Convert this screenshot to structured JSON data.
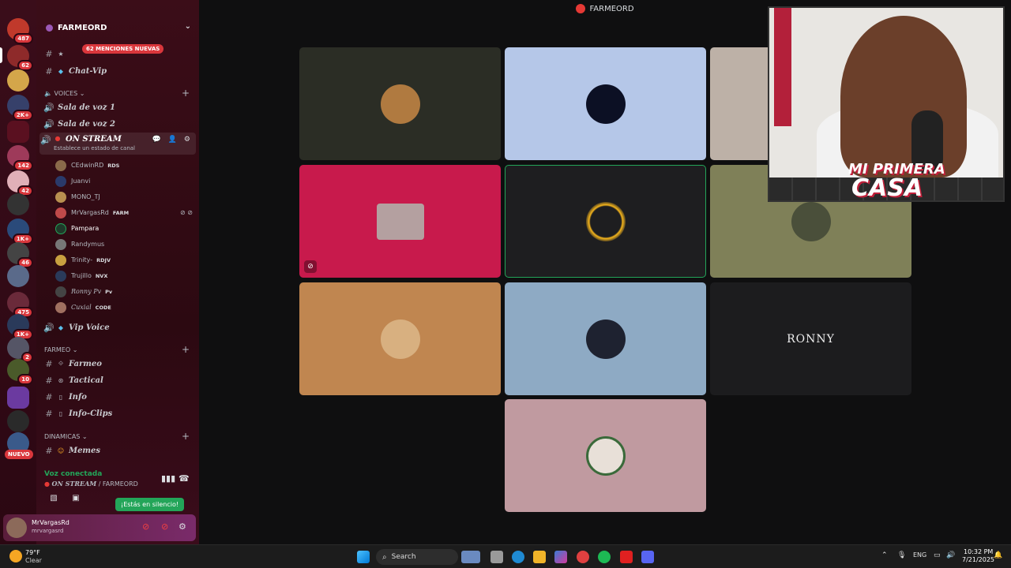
{
  "window": {
    "title": "FARMEORD"
  },
  "rail": {
    "badges": [
      "487",
      "62",
      "2K+",
      "142",
      "42",
      "1K+",
      "46",
      "475",
      "1K+",
      "2",
      "10"
    ],
    "new_label": "NUEVO"
  },
  "server": {
    "name": "FARMEORD",
    "mentions_pill": "62 MENCIONES NUEVAS"
  },
  "channels": {
    "chat_vip": "Chat-Vip",
    "voices_cat": "VOICES",
    "sala1": "Sala de voz 1",
    "sala2": "Sala de voz 2",
    "on_stream": "ON STREAM",
    "on_stream_status": "Establece un estado de canal",
    "vip_voice": "Vip Voice",
    "farmeo_cat": "FARMEO",
    "farmeo": "Farmeo",
    "tactical": "Tactical",
    "info": "Info",
    "info_clips": "Info-Clips",
    "dinamicas_cat": "DINAMICAS",
    "memes": "Memes"
  },
  "voice_users": [
    {
      "name": "CEdwinRD",
      "tag": "RDS"
    },
    {
      "name": "Juanvi",
      "tag": ""
    },
    {
      "name": "MONO_TJ",
      "tag": ""
    },
    {
      "name": "MrVargasRd",
      "tag": "FARM"
    },
    {
      "name": "Pampara",
      "tag": ""
    },
    {
      "name": "Randymus",
      "tag": ""
    },
    {
      "name": "Trinity-",
      "tag": "RDJV"
    },
    {
      "name": "Trujillo",
      "tag": "NVX"
    },
    {
      "name": "Ronny Pv",
      "tag": "Pv"
    },
    {
      "name": "Cuxial",
      "tag": "CODE"
    }
  ],
  "voice_status": {
    "title": "Voz conectada",
    "channel": "ON STREAM",
    "server": "/ FARMEORD"
  },
  "tooltip": "¡Estás en silencio!",
  "user": {
    "display": "MrVargasRd",
    "username": "mrvargasrd"
  },
  "stream_grid": {
    "tile_text": "RONNY"
  },
  "webcam": {
    "overlay_line1": "MI PRIMERA",
    "overlay_line2": "CASA"
  },
  "taskbar": {
    "weather_temp": "79°F",
    "weather_desc": "Clear",
    "search_label": "Search",
    "lang": "ENG",
    "time": "10:32 PM",
    "date": "7/21/2025"
  },
  "colors": {
    "accent_green": "#23a559",
    "badge_red": "#da373c",
    "sidebar_bg": "#3b0d18"
  }
}
